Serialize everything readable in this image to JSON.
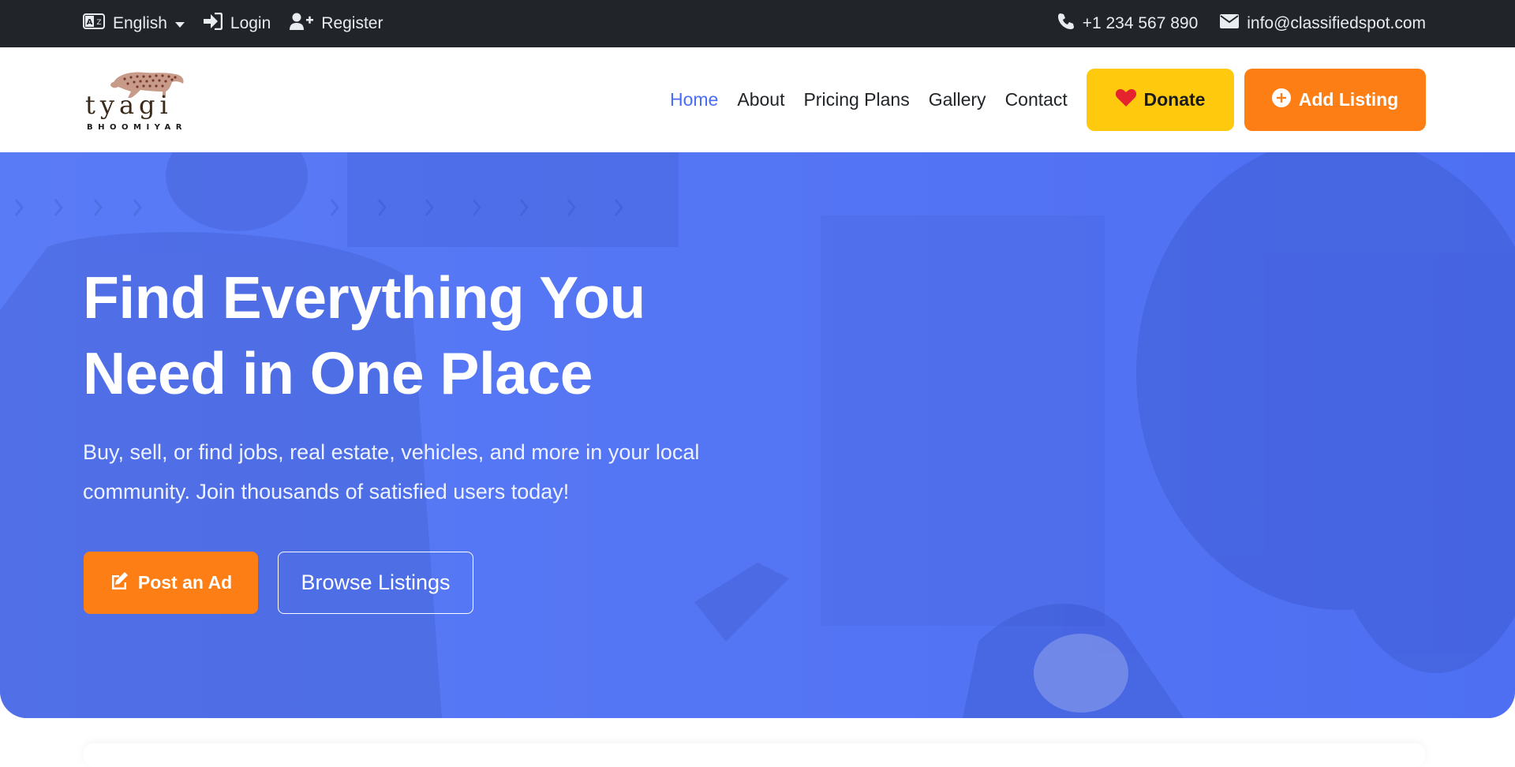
{
  "topbar": {
    "language": "English",
    "login": "Login",
    "register": "Register",
    "phone": "+1 234 567 890",
    "email": "info@classifiedspot.com"
  },
  "logo": {
    "name": "t y a g i",
    "tagline": "BHOOMIYAR"
  },
  "nav": {
    "items": [
      {
        "label": "Home",
        "active": true
      },
      {
        "label": "About"
      },
      {
        "label": "Pricing Plans"
      },
      {
        "label": "Gallery"
      },
      {
        "label": "Contact"
      }
    ],
    "donate": "Donate",
    "add_listing": "Add Listing"
  },
  "hero": {
    "title_line1": "Find Everything You",
    "title_line2": "Need in One Place",
    "subtitle_line1": "Buy, sell, or find jobs, real estate, vehicles, and more in your local",
    "subtitle_line2": "community. Join thousands of satisfied users today!",
    "post_ad": "Post an Ad",
    "browse": "Browse Listings"
  },
  "colors": {
    "topbar": "#212529",
    "accent_blue": "#4a6cf7",
    "hero_overlay": "#587af5",
    "donate_yellow": "#ffc90e",
    "orange": "#fd7e14",
    "heart_red": "#e5232f"
  },
  "icons": {
    "language": "language-icon",
    "login": "sign-in-icon",
    "register": "user-plus-icon",
    "phone": "phone-icon",
    "email": "envelope-icon",
    "donate": "heart-icon",
    "add": "plus-circle-icon",
    "post": "edit-icon"
  }
}
